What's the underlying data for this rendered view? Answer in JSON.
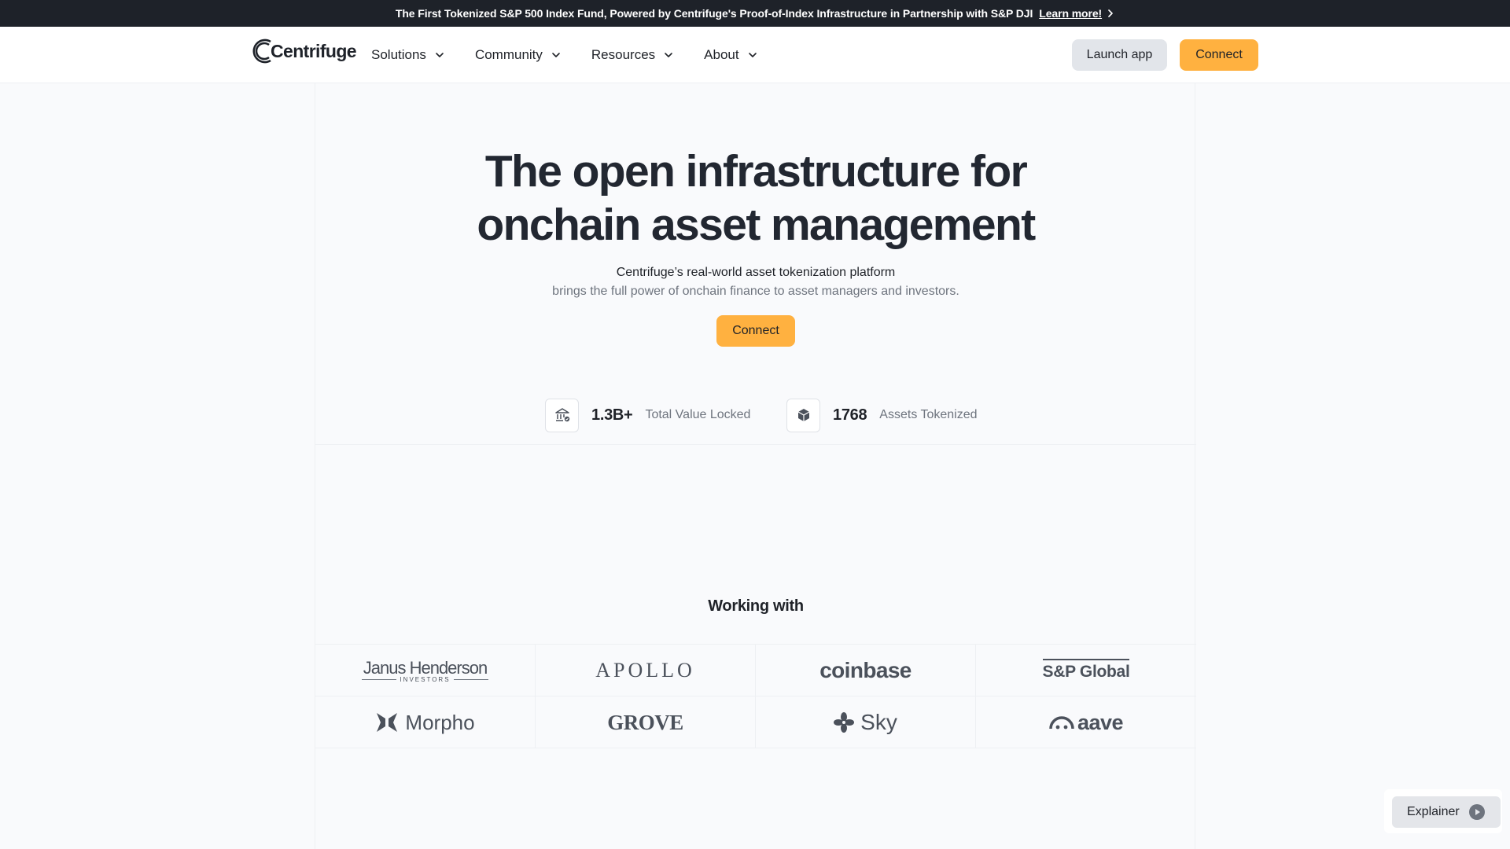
{
  "announcement": {
    "text": "The First Tokenized S&P 500 Index Fund, Powered by Centrifuge's Proof-of-Index Infrastructure in Partnership with S&P DJI",
    "link_label": "Learn more!"
  },
  "header": {
    "logo_text": "Centrifuge",
    "nav": [
      {
        "label": "Solutions"
      },
      {
        "label": "Community"
      },
      {
        "label": "Resources"
      },
      {
        "label": "About"
      }
    ],
    "launch_label": "Launch app",
    "connect_label": "Connect"
  },
  "hero": {
    "title_line1": "The open infrastructure for",
    "title_line2": "onchain asset management",
    "subtitle1": "Centrifuge’s real-world asset tokenization platform",
    "subtitle2": "brings the full power of onchain finance to asset managers and investors.",
    "connect_label": "Connect"
  },
  "stats": [
    {
      "value": "1.3B+",
      "label": "Total Value Locked",
      "icon": "bank-icon"
    },
    {
      "value": "1768",
      "label": "Assets Tokenized",
      "icon": "cube-icon"
    }
  ],
  "partners": {
    "title": "Working with",
    "logos": [
      {
        "name": "Janus Henderson",
        "sub": "INVESTORS"
      },
      {
        "name": "APOLLO"
      },
      {
        "name": "coinbase"
      },
      {
        "name": "S&P Global"
      },
      {
        "name": "Morpho"
      },
      {
        "name": "GROVE"
      },
      {
        "name": "Sky"
      },
      {
        "name": "aave"
      }
    ]
  },
  "explainer": {
    "label": "Explainer"
  },
  "colors": {
    "accent": "#ffb140",
    "dark": "#1e2229",
    "muted_text": "#6e747e"
  }
}
